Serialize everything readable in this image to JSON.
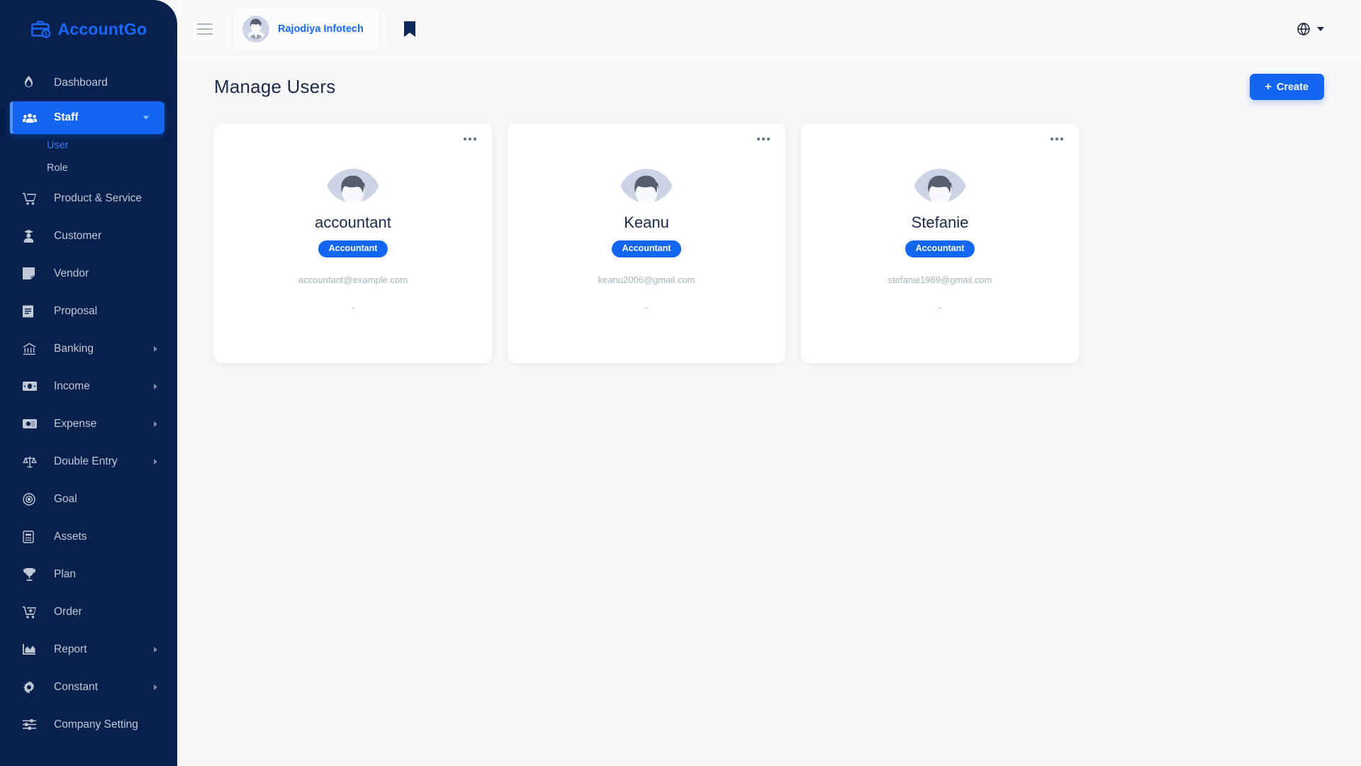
{
  "brand": {
    "name": "AccountGo",
    "logo_icon": "briefcase-dollar-icon",
    "color": "#1769ff"
  },
  "sidebar": {
    "items": [
      {
        "label": "Dashboard",
        "icon": "flame-icon",
        "active": false,
        "expandable": false
      },
      {
        "label": "Staff",
        "icon": "users-icon",
        "active": true,
        "expandable": true
      },
      {
        "label": "Product & Service",
        "icon": "cart-icon",
        "active": false,
        "expandable": false
      },
      {
        "label": "Customer",
        "icon": "customer-icon",
        "active": false,
        "expandable": false
      },
      {
        "label": "Vendor",
        "icon": "vendor-icon",
        "active": false,
        "expandable": false
      },
      {
        "label": "Proposal",
        "icon": "receipt-icon",
        "active": false,
        "expandable": false
      },
      {
        "label": "Banking",
        "icon": "bank-icon",
        "active": false,
        "expandable": true
      },
      {
        "label": "Income",
        "icon": "banknote-icon",
        "active": false,
        "expandable": true
      },
      {
        "label": "Expense",
        "icon": "money-icon",
        "active": false,
        "expandable": true
      },
      {
        "label": "Double Entry",
        "icon": "scale-icon",
        "active": false,
        "expandable": true
      },
      {
        "label": "Goal",
        "icon": "target-icon",
        "active": false,
        "expandable": false
      },
      {
        "label": "Assets",
        "icon": "calculator-icon",
        "active": false,
        "expandable": false
      },
      {
        "label": "Plan",
        "icon": "trophy-icon",
        "active": false,
        "expandable": false
      },
      {
        "label": "Order",
        "icon": "order-cart-icon",
        "active": false,
        "expandable": false
      },
      {
        "label": "Report",
        "icon": "chart-icon",
        "active": false,
        "expandable": true
      },
      {
        "label": "Constant",
        "icon": "gear-icon",
        "active": false,
        "expandable": true
      },
      {
        "label": "Company Setting",
        "icon": "sliders-icon",
        "active": false,
        "expandable": false
      }
    ],
    "staff_submenu": [
      {
        "label": "User",
        "current": true
      },
      {
        "label": "Role",
        "current": false
      }
    ]
  },
  "topbar": {
    "menu_toggle_icon": "hamburger-icon",
    "company": {
      "name": "Rajodiya Infotech",
      "avatar_icon": "user-avatar-icon"
    },
    "bookmark_icon": "bookmark-icon",
    "language_icon": "globe-icon",
    "language_chevron_icon": "chevron-down-icon"
  },
  "page": {
    "title": "Manage Users",
    "create_button": {
      "label": "Create",
      "icon": "plus-icon"
    }
  },
  "users": [
    {
      "name": "accountant",
      "role": "Accountant",
      "email": "accountant@example.com",
      "extra": "-",
      "menu_icon": "more-options-icon",
      "avatar_icon": "user-avatar-icon"
    },
    {
      "name": "Keanu",
      "role": "Accountant",
      "email": "keanu2006@gmail.com",
      "extra": "-",
      "menu_icon": "more-options-icon",
      "avatar_icon": "user-avatar-icon"
    },
    {
      "name": "Stefanie",
      "role": "Accountant",
      "email": "stefanie1989@gmail.com",
      "extra": "-",
      "menu_icon": "more-options-icon",
      "avatar_icon": "user-avatar-icon"
    }
  ]
}
